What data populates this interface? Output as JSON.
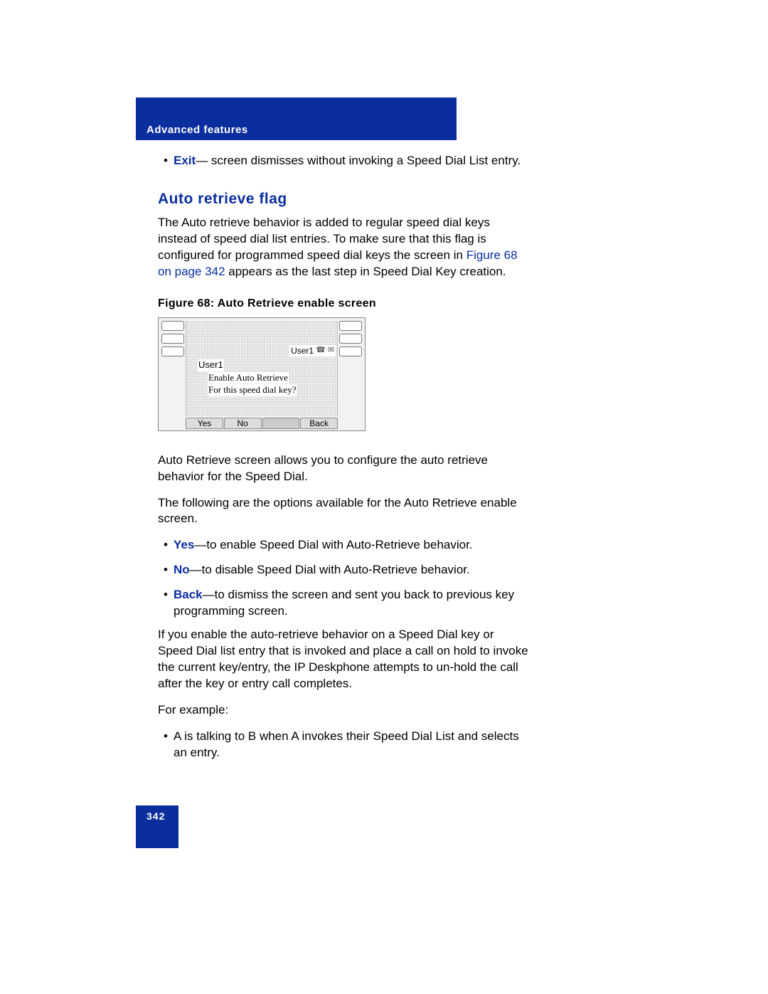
{
  "header": {
    "section_title": "Advanced features"
  },
  "bullet_exit": {
    "label": "Exit",
    "desc": "— screen dismisses without invoking a Speed Dial List entry."
  },
  "heading_auto": "Auto retrieve flag",
  "para_auto_1a": "The Auto retrieve behavior is added to regular speed dial keys instead of speed dial list entries. To make sure that this flag is configured for programmed speed dial keys the screen in ",
  "para_auto_link": "Figure 68 on page 342",
  "para_auto_1b": " appears as the last step in Speed Dial Key creation.",
  "figure_caption": "Figure 68: Auto Retrieve enable screen",
  "phone": {
    "user_label": "User1",
    "line1": "User1",
    "line2": "Enable Auto Retrieve",
    "line3": "For this speed dial key?",
    "softkeys": {
      "k1": "Yes",
      "k2": "No",
      "k3": "",
      "k4": "Back"
    }
  },
  "para_after_fig": "Auto Retrieve screen allows you to configure the auto retrieve behavior for the Speed Dial.",
  "para_options_intro": "The following are the options available for the Auto Retrieve enable screen.",
  "opt_yes": {
    "label": "Yes",
    "desc": "—to enable Speed Dial with Auto-Retrieve behavior."
  },
  "opt_no": {
    "label": "No",
    "desc": "—to disable Speed Dial with Auto-Retrieve behavior."
  },
  "opt_back": {
    "label": "Back",
    "desc": "—to dismiss the screen and sent you back to previous key programming screen."
  },
  "para_enable_note": "If you enable the auto-retrieve behavior on a Speed Dial key or Speed Dial list entry that is invoked and place a call on hold to invoke the current key/entry, the IP Deskphone attempts to un-hold the call after the key or entry call completes.",
  "para_example": "For example:",
  "bullet_example": "A is talking to B when A invokes their Speed Dial List and selects an entry.",
  "footer": {
    "page_number": "342"
  }
}
